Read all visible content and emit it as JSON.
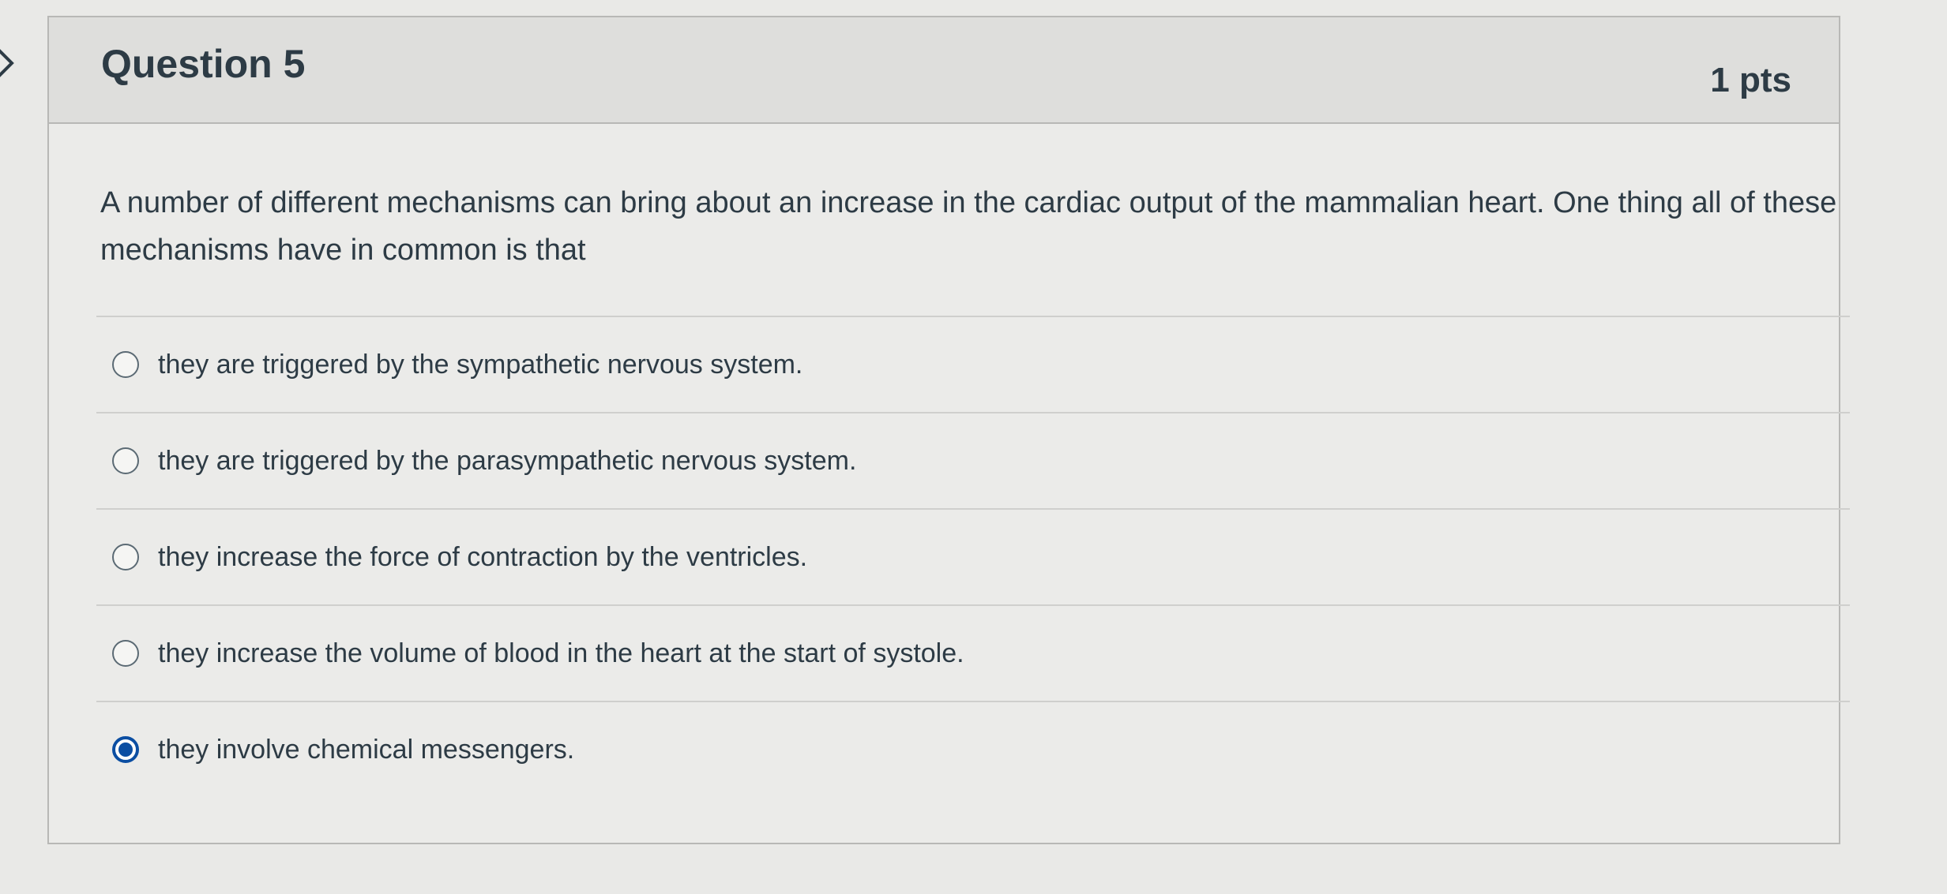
{
  "question": {
    "title": "Question 5",
    "points": "1 pts",
    "text": "A number of different mechanisms can bring about an increase in the cardiac output of the mammalian heart. One thing all of these mechanisms have in common is that"
  },
  "answers": [
    {
      "label": "they are triggered by the sympathetic nervous system.",
      "selected": false
    },
    {
      "label": "they are triggered by the parasympathetic nervous system.",
      "selected": false
    },
    {
      "label": "they increase the force of contraction by the ventricles.",
      "selected": false
    },
    {
      "label": "they increase the volume of blood in the heart at the start of systole.",
      "selected": false
    },
    {
      "label": "they involve chemical messengers.",
      "selected": true
    }
  ],
  "colors": {
    "accent": "#0b4ea2",
    "text": "#2d3b45",
    "header_bg": "#dededc"
  },
  "icons": {
    "nav": "chevron-right-icon",
    "radio": "radio-button-icon"
  }
}
